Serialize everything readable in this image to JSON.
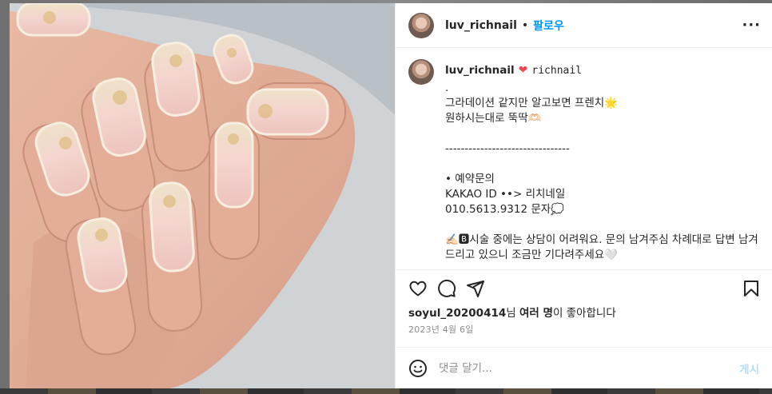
{
  "post": {
    "username": "luv_richnail",
    "follow_label": "팔로우",
    "separator": "•",
    "more_label": "···",
    "photo_alt": "nail photo"
  },
  "caption": {
    "username": "luv_richnail",
    "heart": "❤",
    "tag": "richnail",
    "lines": [
      ".",
      "그라데이션 같지만 알고보면 프렌치🌟",
      "원하시는대로 뚝딱🫶🏻",
      "",
      "--------------------------------",
      "",
      "• 예약문의",
      "KAKAO ID ••> 리치네일",
      "010.5613.9312 문자💭",
      "",
      "✍🏻🅱시술 중에는 상담이 어려워요. 문의 남겨주심 차례대로 답변 남겨드리고 있으니 조금만 기다려주세요🤍",
      "",
      "--------------------------------"
    ]
  },
  "likes": {
    "user": "soyul_20200414",
    "suffix_1": "님 ",
    "others": "여러 명",
    "suffix_2": "이 좋아합니다"
  },
  "date": "2023년 4월 6일",
  "comment": {
    "placeholder": "댓글 달기...",
    "post_label": "게시"
  },
  "icons": [
    "heart-icon",
    "comment-icon",
    "share-icon",
    "bookmark-icon",
    "emoji-icon"
  ],
  "colors": {
    "accent": "#0095f6",
    "heart": "#ed4956",
    "muted": "#8e8e8e"
  }
}
